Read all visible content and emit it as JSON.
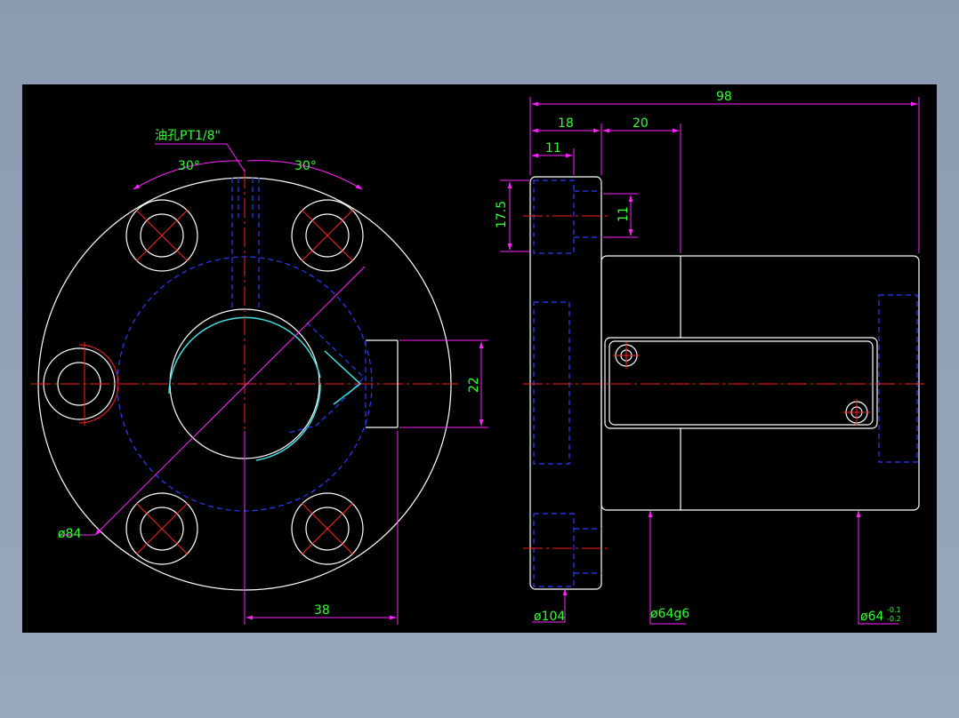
{
  "drawing": {
    "labels": {
      "oil_hole": "油孔PT1/8\"",
      "angle_left": "30°",
      "angle_right": "30°",
      "dia_84": "ø84",
      "dim_38": "38",
      "dim_22": "22",
      "dim_98": "98",
      "dim_18": "18",
      "dim_20": "20",
      "dim_11_top": "11",
      "dim_17_5": "17.5",
      "dim_11_side": "11",
      "dia_104": "ø104",
      "dia_64g6": "ø64g6",
      "dia_64": "ø64",
      "tol_upper": "-0.1",
      "tol_lower": "-0.2"
    },
    "colors": {
      "background": "#000000",
      "outline": "#ffffff",
      "center_line": "#ff2020",
      "hidden_line": "#2a3cff",
      "dimension": "#ff22ff",
      "text": "#30ff30",
      "thread": "#40e0e0"
    }
  }
}
